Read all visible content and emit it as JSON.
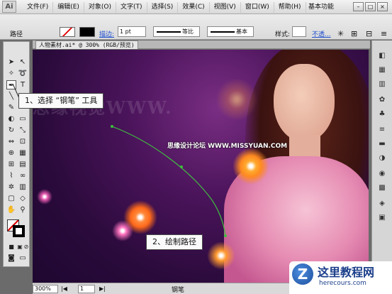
{
  "app": {
    "logo": "Ai",
    "workspace": "基本功能"
  },
  "menu": [
    "文件(F)",
    "编辑(E)",
    "对象(O)",
    "文字(T)",
    "选择(S)",
    "效果(C)",
    "视图(V)",
    "窗口(W)",
    "帮助(H)"
  ],
  "controlbar": {
    "selection_label": "路径",
    "stroke_label": "描边:",
    "stroke_weight": "1 pt",
    "profile": "等比",
    "brush": "基本",
    "style_label": "样式:",
    "opacity_label": "不透..."
  },
  "document": {
    "tab_title": "人物素材.ai* @ 300% (RGB/预览)"
  },
  "canvas": {
    "watermark": "思缘视觉WWW.",
    "site_text": "思缘设计论坛 WWW.MISSYUAN.COM"
  },
  "callouts": {
    "step1": "1、选择 “钢笔” 工具",
    "step2": "2、绘制路径"
  },
  "statusbar": {
    "zoom": "300%",
    "page": "1",
    "current_tool": "钢笔"
  },
  "brand": {
    "mark": "Z",
    "name": "这里教程网",
    "url": "herecours.com"
  },
  "colors": {
    "canvas_bg": "#3a0f4d",
    "path_stroke": "#3fbf3f",
    "brand_blue": "#1b3e8a"
  }
}
